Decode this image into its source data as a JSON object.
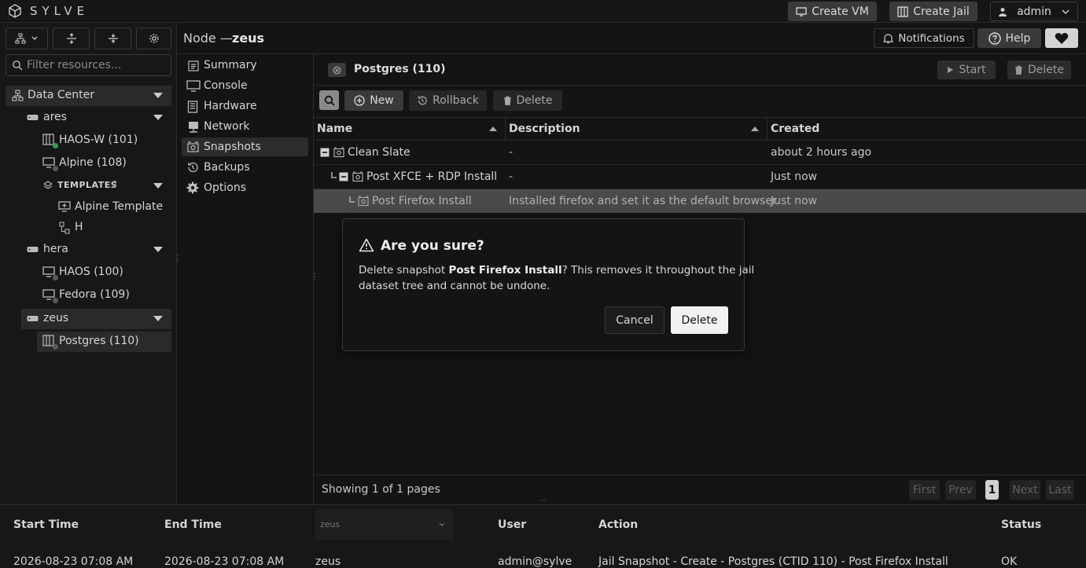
{
  "app": {
    "brand": "SYLVE"
  },
  "topbar": {
    "create_vm": "Create VM",
    "create_jail": "Create Jail",
    "user": "admin"
  },
  "header": {
    "node_prefix": "Node —",
    "node_name": "zeus",
    "notifications": "Notifications",
    "help": "Help"
  },
  "sidebar": {
    "filter_placeholder": "Filter resources...",
    "datacenter": "Data Center",
    "nodes": [
      {
        "name": "ares",
        "items": [
          "HAOS-W (101)",
          "Alpine (108)"
        ],
        "templates_label": "TEMPLATES",
        "templates_count": "2",
        "templates": [
          "Alpine Template",
          "H"
        ]
      },
      {
        "name": "hera",
        "items": [
          "HAOS (100)",
          "Fedora (109)"
        ]
      },
      {
        "name": "zeus",
        "items": [
          "Postgres (110)"
        ]
      }
    ]
  },
  "nav": {
    "items": [
      "Summary",
      "Console",
      "Hardware",
      "Network",
      "Snapshots",
      "Backups",
      "Options"
    ]
  },
  "panel": {
    "title": "Postgres (110)",
    "start": "Start",
    "delete": "Delete",
    "toolbar": {
      "new": "New",
      "rollback": "Rollback",
      "delete": "Delete"
    },
    "columns": [
      "Name",
      "Description",
      "Created"
    ],
    "rows": [
      {
        "name": "Clean Slate",
        "description": "-",
        "created": "about 2 hours ago"
      },
      {
        "name": "Post XFCE + RDP Install",
        "description": "-",
        "created": "Just now"
      },
      {
        "name": "Post Firefox Install",
        "description": "Installed firefox and set it as the default browser.",
        "created": "Just now"
      }
    ],
    "footer": {
      "showing": "Showing 1 of 1 pages",
      "first": "First",
      "prev": "Prev",
      "page": "1",
      "next": "Next",
      "last": "Last"
    }
  },
  "dialog": {
    "title": "Are you sure?",
    "line1_pre": "Delete snapshot ",
    "line1_bold": "Post Firefox Install",
    "line1_post": "? This removes it throughout the jail",
    "line2": "dataset tree and cannot be undone.",
    "cancel": "Cancel",
    "confirm": "Delete"
  },
  "log": {
    "columns": [
      "Start Time",
      "End Time",
      "User",
      "Action",
      "Status"
    ],
    "node_filter": "zeus",
    "row": {
      "start": "2026-08-23 07:08 AM",
      "end": "2026-08-23 07:08 AM",
      "node": "zeus",
      "user": "admin@sylve",
      "action": "Jail Snapshot - Create - Postgres (CTID 110) - Post Firefox Install",
      "status": "OK"
    }
  },
  "colors": {
    "bg": "#141414",
    "panel": "#1a1a1a",
    "selected_row": "#4a4a4a",
    "status_green": "#2ea043"
  }
}
